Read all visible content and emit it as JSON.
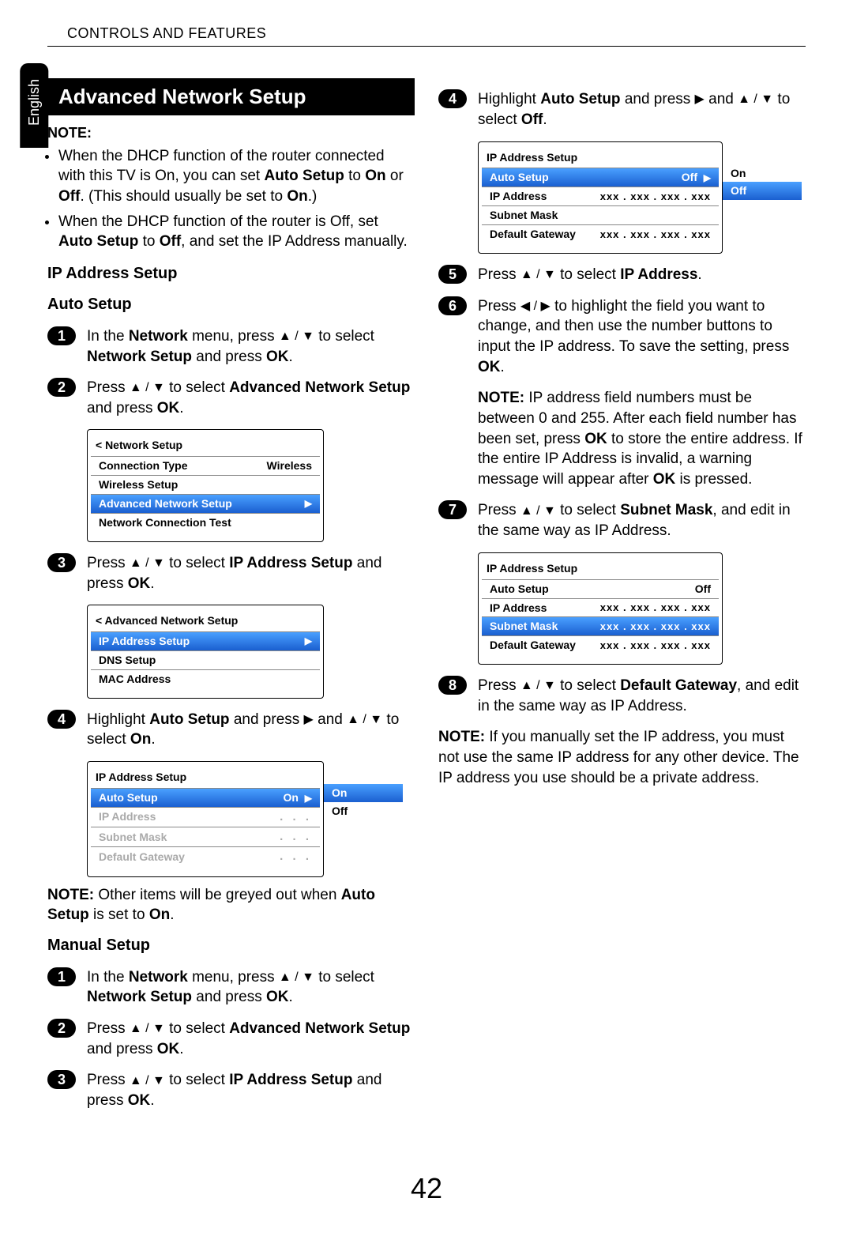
{
  "header": "CONTROLS AND FEATURES",
  "langTab": "English",
  "banner": "Advanced Network Setup",
  "noteLabel": "NOTE:",
  "notes": [
    {
      "pre": "When the DHCP function of the router connected with this TV is On, you can set ",
      "b1": "Auto Setup",
      "mid": " to ",
      "b2": "On",
      "mid2": " or ",
      "b3": "Off",
      "post": ". (This should usually be set to ",
      "b4": "On",
      "post2": ".)"
    },
    {
      "pre": "When the DHCP function of the router is Off, set ",
      "b1": "Auto Setup",
      "mid": " to ",
      "b2": "Off",
      "post": ", and set the IP Address manually."
    }
  ],
  "h3a": "IP Address Setup",
  "h3b": "Auto Setup",
  "h3c": "Manual Setup",
  "autoSteps": {
    "s1": {
      "pre": "In the ",
      "b1": "Network",
      "mid": " menu, press ",
      "sym": "▲ / ▼",
      "mid2": " to select ",
      "b2": "Network Setup",
      "mid3": " and press ",
      "b3": "OK",
      "post": "."
    },
    "s2": {
      "pre": "Press ",
      "sym": "▲ / ▼",
      "mid": " to select ",
      "b1": "Advanced Network Setup",
      "mid2": " and press ",
      "b2": "OK",
      "post": "."
    },
    "s3": {
      "pre": "Press ",
      "sym": "▲ / ▼",
      "mid": " to select ",
      "b1": "IP Address Setup",
      "mid2": " and press ",
      "b2": "OK",
      "post": "."
    },
    "s4": {
      "pre": "Highlight ",
      "b1": "Auto Setup",
      "mid": " and press ",
      "sym1": "▶",
      "mid2": " and ",
      "sym2": "▲ / ▼",
      "mid3": " to select ",
      "b2": "On",
      "post": "."
    }
  },
  "autoNote": {
    "pre": "NOTE:",
    "mid": " Other items will be greyed out when ",
    "b": "Auto Setup",
    "mid2": " is set to ",
    "b2": "On",
    "post": "."
  },
  "manualSteps": {
    "s1": {
      "pre": "In the ",
      "b1": "Network",
      "mid": " menu, press ",
      "sym": "▲ / ▼",
      "mid2": " to select ",
      "b2": "Network Setup",
      "mid3": " and press ",
      "b3": "OK",
      "post": "."
    },
    "s2": {
      "pre": "Press ",
      "sym": "▲ / ▼",
      "mid": " to select ",
      "b1": "Advanced Network Setup",
      "mid2": " and press ",
      "b2": "OK",
      "post": "."
    },
    "s3": {
      "pre": "Press ",
      "sym": "▲ / ▼",
      "mid": " to select ",
      "b1": "IP Address Setup",
      "mid2": " and press ",
      "b2": "OK",
      "post": "."
    },
    "s4": {
      "pre": "Highlight ",
      "b1": "Auto Setup",
      "mid": " and press ",
      "sym1": "▶",
      "mid2": " and ",
      "sym2": "▲ / ▼",
      "mid3": " to select ",
      "b2": "Off",
      "post": "."
    },
    "s5": {
      "pre": "Press ",
      "sym": "▲ / ▼",
      "mid": " to select ",
      "b1": "IP Address",
      "post": "."
    },
    "s6": {
      "pre": "Press ",
      "sym": "◀ / ▶",
      "mid": " to highlight the field you want to change, and then use the number buttons to input the IP address. To save the setting, press ",
      "b": "OK",
      "post": "."
    },
    "s6note": {
      "pre": "NOTE:",
      "mid": " IP address field numbers must be between 0 and 255. After each field number has been set, press ",
      "b": "OK",
      "mid2": " to store the entire address. If the entire IP Address is invalid, a warning message will appear after ",
      "b2": "OK",
      "post": " is pressed."
    },
    "s7": {
      "pre": "Press ",
      "sym": "▲ / ▼",
      "mid": " to select ",
      "b1": "Subnet Mask",
      "post": ", and edit in the same way as IP Address."
    },
    "s8": {
      "pre": "Press ",
      "sym": "▲ / ▼",
      "mid": " to select ",
      "b1": "Default Gateway",
      "post": ", and edit in the same way as IP Address."
    }
  },
  "finalNote": {
    "pre": "NOTE:",
    "post": " If you manually set the IP address, you must not use the same IP address for any other device. The IP address you use should be a private address."
  },
  "menu1": {
    "title": "< Network Setup",
    "r1l": "Connection Type",
    "r1v": "Wireless",
    "r2": "Wireless Setup",
    "r3": "Advanced Network Setup",
    "r4": "Network Connection Test"
  },
  "menu2": {
    "title": "< Advanced Network Setup",
    "r1": "IP Address Setup",
    "r2": "DNS Setup",
    "r3": "MAC Address"
  },
  "menu3": {
    "title": "IP Address Setup",
    "r1l": "Auto Setup",
    "r1v": "On",
    "opt1": "On",
    "opt2": "Off",
    "r2": "IP Address",
    "r3": "Subnet Mask",
    "r4": "Default Gateway",
    "dots": ".      .      ."
  },
  "menu4": {
    "title": "IP Address Setup",
    "r1l": "Auto Setup",
    "r1v": "Off",
    "opt1": "On",
    "opt2": "Off",
    "r2": "IP Address",
    "r3": "Subnet Mask",
    "r4": "Default Gateway",
    "xxx": "xxx . xxx . xxx . xxx"
  },
  "menu5": {
    "title": "IP Address Setup",
    "r1l": "Auto Setup",
    "r1v": "Off",
    "r2": "IP Address",
    "r3": "Subnet Mask",
    "r4": "Default Gateway",
    "xxx": "xxx . xxx . xxx . xxx"
  },
  "pageNum": "42"
}
